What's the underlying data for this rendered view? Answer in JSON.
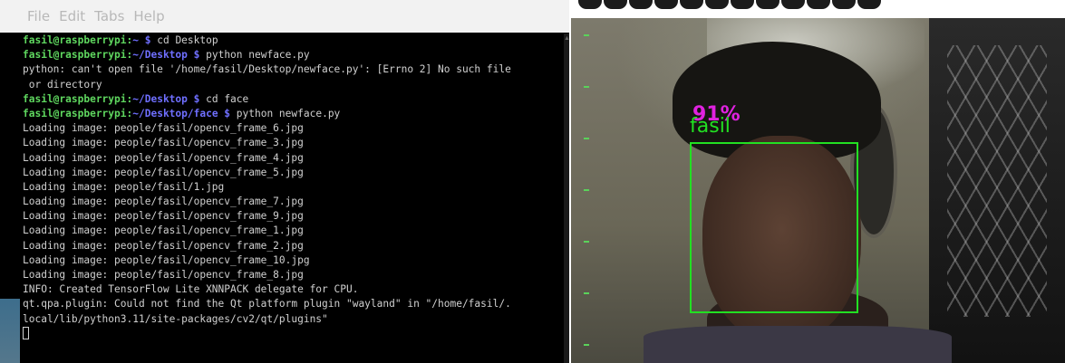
{
  "terminal": {
    "menu": [
      "File",
      "Edit",
      "Tabs",
      "Help"
    ],
    "lines": [
      {
        "user": "fasil@raspberrypi",
        "sep": ":",
        "path": "~",
        "prompt": " $ ",
        "cmd": "cd Desktop"
      },
      {
        "user": "fasil@raspberrypi",
        "sep": ":",
        "path": "~/Desktop",
        "prompt": " $ ",
        "cmd": "python newface.py"
      },
      {
        "text": "python: can't open file '/home/fasil/Desktop/newface.py': [Errno 2] No such file"
      },
      {
        "text": " or directory"
      },
      {
        "user": "fasil@raspberrypi",
        "sep": ":",
        "path": "~/Desktop",
        "prompt": " $ ",
        "cmd": "cd face"
      },
      {
        "user": "fasil@raspberrypi",
        "sep": ":",
        "path": "~/Desktop/face",
        "prompt": " $ ",
        "cmd": "python newface.py"
      },
      {
        "text": "Loading image: people/fasil/opencv_frame_6.jpg"
      },
      {
        "text": "Loading image: people/fasil/opencv_frame_3.jpg"
      },
      {
        "text": "Loading image: people/fasil/opencv_frame_4.jpg"
      },
      {
        "text": "Loading image: people/fasil/opencv_frame_5.jpg"
      },
      {
        "text": "Loading image: people/fasil/1.jpg"
      },
      {
        "text": "Loading image: people/fasil/opencv_frame_7.jpg"
      },
      {
        "text": "Loading image: people/fasil/opencv_frame_9.jpg"
      },
      {
        "text": "Loading image: people/fasil/opencv_frame_1.jpg"
      },
      {
        "text": "Loading image: people/fasil/opencv_frame_2.jpg"
      },
      {
        "text": "Loading image: people/fasil/opencv_frame_10.jpg"
      },
      {
        "text": "Loading image: people/fasil/opencv_frame_8.jpg"
      },
      {
        "text": "INFO: Created TensorFlow Lite XNNPACK delegate for CPU."
      },
      {
        "text": "qt.qpa.plugin: Could not find the Qt platform plugin \"wayland\" in \"/home/fasil/."
      },
      {
        "text": "local/lib/python3.11/site-packages/cv2/qt/plugins\""
      }
    ]
  },
  "camera": {
    "detected_name": "fasil",
    "confidence": "91%",
    "box_color": "#22e022",
    "confidence_color": "#e022e0"
  },
  "colors": {
    "terminal_bg": "#000000",
    "user_prompt": "#5fd75f",
    "path_prompt": "#6f6fff",
    "output_text": "#d0d0d0"
  }
}
